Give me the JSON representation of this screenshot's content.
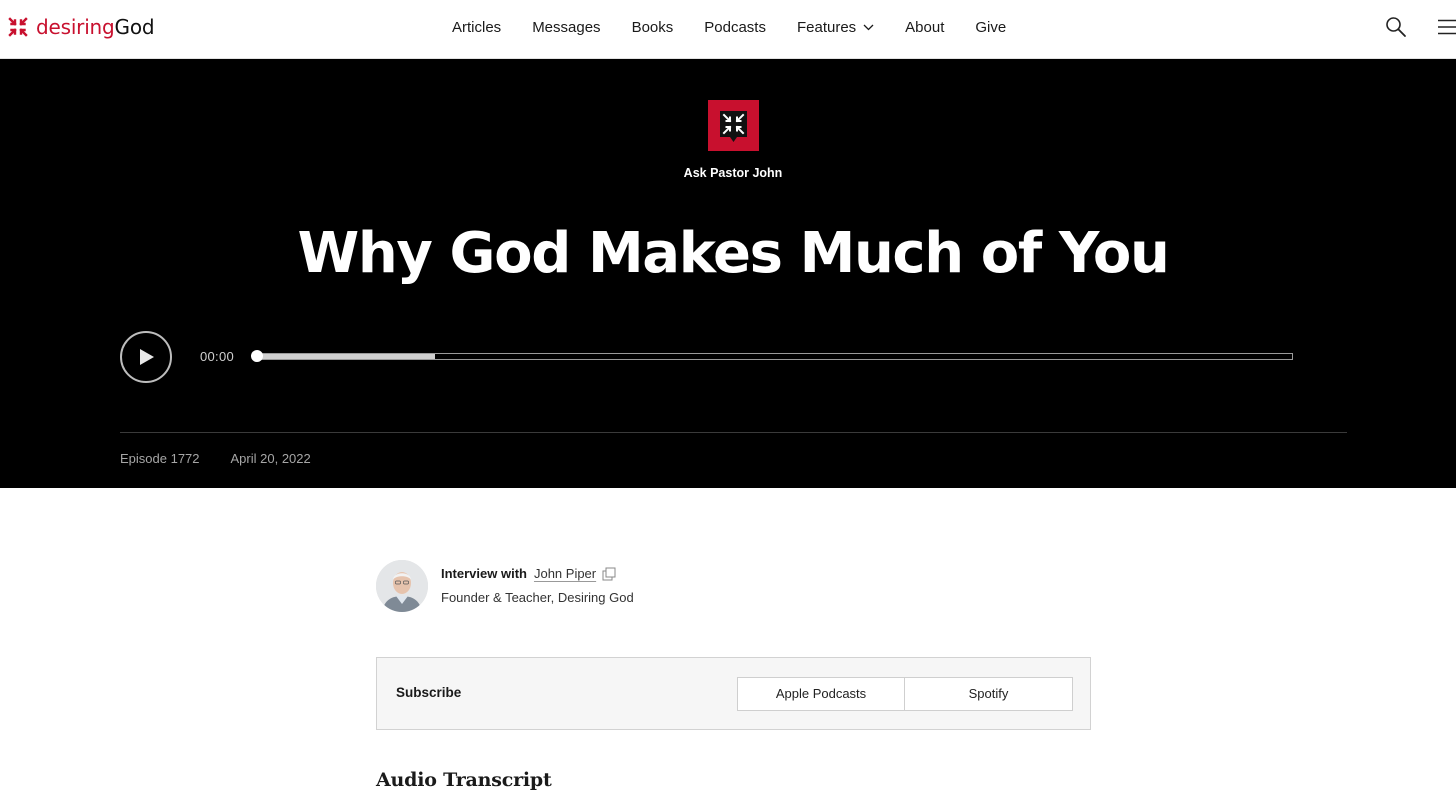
{
  "brand": {
    "name_part1": "desiring",
    "name_part2": "God",
    "accent_color": "#c8102e"
  },
  "nav": {
    "items": [
      {
        "label": "Articles"
      },
      {
        "label": "Messages"
      },
      {
        "label": "Books"
      },
      {
        "label": "Podcasts"
      },
      {
        "label": "Features",
        "has_dropdown": true
      },
      {
        "label": "About"
      },
      {
        "label": "Give"
      }
    ],
    "search_icon": "search-icon",
    "menu_icon": "hamburger-menu-icon"
  },
  "hero": {
    "series_icon": "ask-pastor-john-logo-icon",
    "series_name": "Ask Pastor John",
    "title": "Why God Makes Much of You",
    "player": {
      "play_icon": "play-icon",
      "current_time": "00:00",
      "progress": 0,
      "buffered": 0.172
    },
    "episode": "Episode 1772",
    "date": "April 20, 2022"
  },
  "author": {
    "prefix": "Interview with",
    "name": "John Piper",
    "role": "Founder & Teacher, Desiring God",
    "avatar_icon": "author-avatar"
  },
  "subscribe": {
    "label": "Subscribe",
    "buttons": [
      {
        "label": "Apple Podcasts"
      },
      {
        "label": "Spotify"
      }
    ]
  },
  "transcript": {
    "heading": "Audio Transcript"
  }
}
